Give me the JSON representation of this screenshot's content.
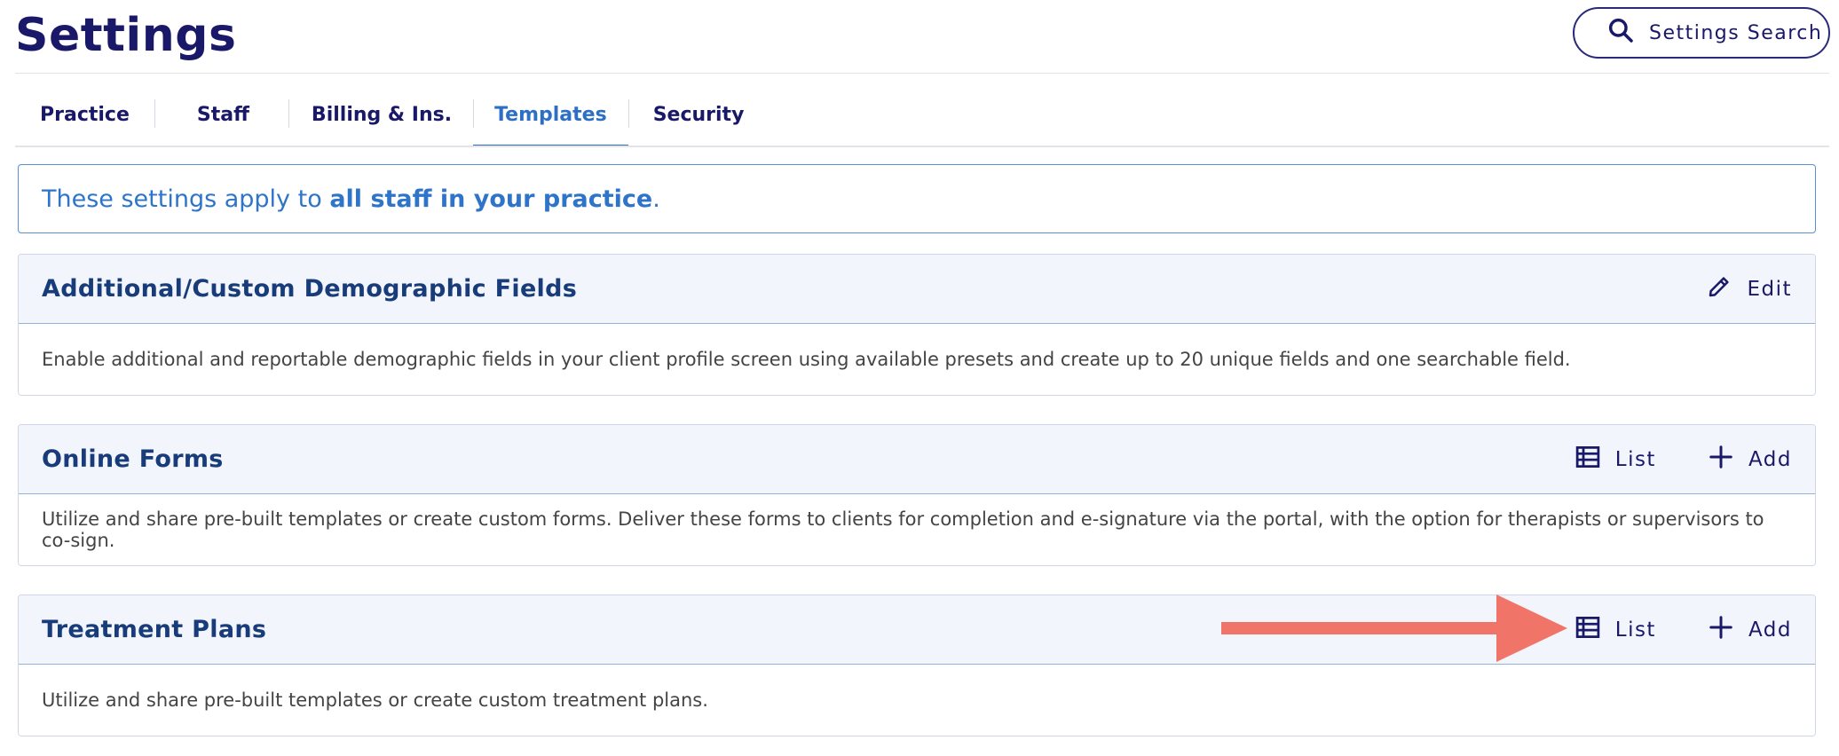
{
  "header": {
    "title": "Settings",
    "search_label": "Settings Search"
  },
  "tabs": [
    {
      "label": "Practice",
      "active": false
    },
    {
      "label": "Staff",
      "active": false
    },
    {
      "label": "Billing & Ins.",
      "active": false
    },
    {
      "label": "Templates",
      "active": true
    },
    {
      "label": "Security",
      "active": false
    }
  ],
  "banner": {
    "prefix": "These settings apply to ",
    "emphasis": "all staff in your practice",
    "suffix": "."
  },
  "sections": [
    {
      "title": "Additional/Custom Demographic Fields",
      "edit_label": "Edit",
      "description": "Enable additional and reportable demographic fields in your client profile screen using available presets and create up to 20 unique fields and one searchable field."
    },
    {
      "title": "Online Forms",
      "list_label": "List",
      "add_label": "Add",
      "description": "Utilize and share pre-built templates or create custom forms. Deliver these forms to clients for completion and e-signature via the portal, with the option for therapists or supervisors to co-sign."
    },
    {
      "title": "Treatment Plans",
      "list_label": "List",
      "add_label": "Add",
      "description": "Utilize and share pre-built templates or create custom treatment plans."
    }
  ],
  "icons": {
    "search": "search-icon",
    "edit": "pencil-icon",
    "list": "list-icon",
    "add": "plus-icon",
    "annotation": "arrow-right-icon"
  },
  "colors": {
    "title": "#1a1868",
    "accent_blue": "#2e6fc6",
    "card_title": "#183b7a",
    "card_header_bg": "#f2f6fc",
    "annotation_arrow": "#f07468"
  }
}
